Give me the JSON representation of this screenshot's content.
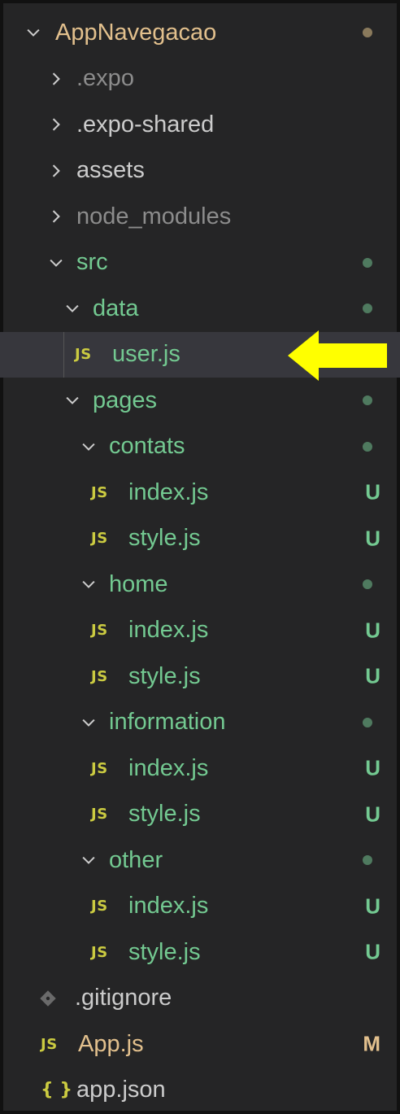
{
  "colors": {
    "panel_bg": "#252526",
    "selected_bg": "#37373d",
    "untracked_green": "#73c991",
    "modified_tan": "#e2c08d",
    "ignored_gray": "#8c8c8c",
    "default_text": "#cccccc",
    "arrow_yellow": "#ffff00"
  },
  "explorer": {
    "root": {
      "label": "AppNavegacao",
      "badge": "dot"
    },
    "rows": [
      {
        "label": ".expo",
        "icon": "chevron-right-icon",
        "status": "ignored"
      },
      {
        "label": ".expo-shared",
        "icon": "chevron-right-icon",
        "status": "normal"
      },
      {
        "label": "assets",
        "icon": "chevron-right-icon",
        "status": "normal"
      },
      {
        "label": "node_modules",
        "icon": "chevron-right-icon",
        "status": "ignored"
      },
      {
        "label": "src",
        "icon": "chevron-down-icon",
        "status": "untracked",
        "badge": "dot"
      },
      {
        "label": "data",
        "icon": "chevron-down-icon",
        "status": "untracked",
        "badge": "dot"
      },
      {
        "label": "user.js",
        "icon": "js-icon",
        "status": "untracked",
        "selected": true
      },
      {
        "label": "pages",
        "icon": "chevron-down-icon",
        "status": "untracked",
        "badge": "dot"
      },
      {
        "label": "contats",
        "icon": "chevron-down-icon",
        "status": "untracked",
        "badge": "dot"
      },
      {
        "label": "index.js",
        "icon": "js-icon",
        "status": "untracked",
        "badge": "U"
      },
      {
        "label": "style.js",
        "icon": "js-icon",
        "status": "untracked",
        "badge": "U"
      },
      {
        "label": "home",
        "icon": "chevron-down-icon",
        "status": "untracked",
        "badge": "dot"
      },
      {
        "label": "index.js",
        "icon": "js-icon",
        "status": "untracked",
        "badge": "U"
      },
      {
        "label": "style.js",
        "icon": "js-icon",
        "status": "untracked",
        "badge": "U"
      },
      {
        "label": "information",
        "icon": "chevron-down-icon",
        "status": "untracked",
        "badge": "dot"
      },
      {
        "label": "index.js",
        "icon": "js-icon",
        "status": "untracked",
        "badge": "U"
      },
      {
        "label": "style.js",
        "icon": "js-icon",
        "status": "untracked",
        "badge": "U"
      },
      {
        "label": "other",
        "icon": "chevron-down-icon",
        "status": "untracked",
        "badge": "dot"
      },
      {
        "label": "index.js",
        "icon": "js-icon",
        "status": "untracked",
        "badge": "U"
      },
      {
        "label": "style.js",
        "icon": "js-icon",
        "status": "untracked",
        "badge": "U"
      },
      {
        "label": ".gitignore",
        "icon": "git-icon",
        "status": "normal"
      },
      {
        "label": "App.js",
        "icon": "js-icon",
        "status": "modified",
        "badge": "M"
      },
      {
        "label": "app.json",
        "icon": "json-icon",
        "status": "normal"
      }
    ],
    "icon_glyphs": {
      "js": "JS",
      "json": "{ }"
    }
  }
}
